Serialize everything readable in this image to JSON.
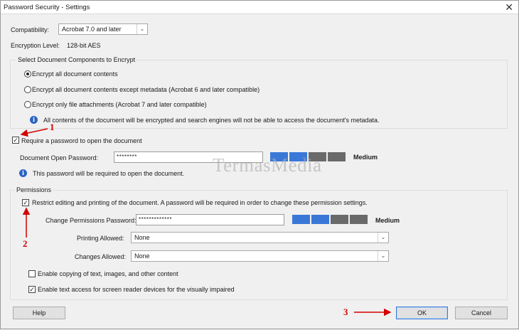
{
  "window": {
    "title": "Password Security - Settings",
    "close_glyph": "✕"
  },
  "compatibility": {
    "label": "Compatibility:",
    "value": "Acrobat 7.0 and later"
  },
  "encryption_level": {
    "label": "Encryption Level:",
    "value": "128-bit AES"
  },
  "components": {
    "title": "Select Document Components to Encrypt",
    "options": [
      {
        "label": "Encrypt all document contents",
        "selected": true
      },
      {
        "label": "Encrypt all document contents except metadata (Acrobat 6 and later compatible)",
        "selected": false
      },
      {
        "label": "Encrypt only file attachments (Acrobat 7 and later compatible)",
        "selected": false
      }
    ],
    "info": "All contents of the document will be encrypted and search engines will not be able to access the document's metadata."
  },
  "open_password": {
    "checkbox_label": "Require a password to open the document",
    "checked": true,
    "field_label": "Document Open Password:",
    "value": "********",
    "strength": "Medium",
    "info": "This password will be required to open the document."
  },
  "permissions": {
    "title": "Permissions",
    "restrict_label": "Restrict editing and printing of the document. A password will be required in order to change these permission settings.",
    "restrict_checked": true,
    "change_password_label": "Change Permissions Password:",
    "change_password_value": "*************",
    "strength": "Medium",
    "printing_label": "Printing Allowed:",
    "printing_value": "None",
    "changes_label": "Changes Allowed:",
    "changes_value": "None",
    "copy_label": "Enable copying of text, images, and other content",
    "copy_checked": false,
    "screen_reader_label": "Enable text access for screen reader devices for the visually impaired",
    "screen_reader_checked": true
  },
  "buttons": {
    "help": "Help",
    "ok": "OK",
    "cancel": "Cancel"
  },
  "annotations": {
    "one": "1",
    "two": "2",
    "three": "3",
    "color": "#d40000"
  },
  "watermark": "TermasMedia",
  "strength_meter": {
    "active_color": "#3a78d8",
    "inactive_color": "#6a6a6a"
  },
  "icons": {
    "dropdown": "chevron-down-icon",
    "info": "info-icon",
    "close": "close-icon"
  }
}
